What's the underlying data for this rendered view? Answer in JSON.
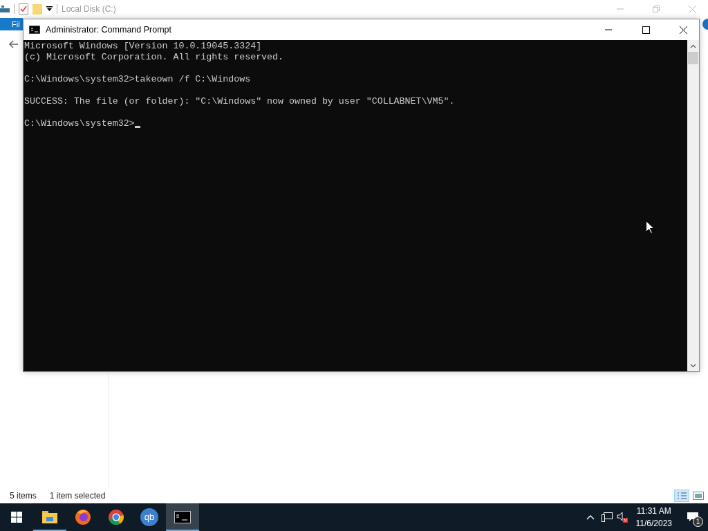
{
  "explorer": {
    "title": "Local Disk (C:)",
    "ribbon_tab": "Fil",
    "status_items": "5 items",
    "status_selected": "1 item selected"
  },
  "console": {
    "title": "Administrator: Command Prompt",
    "blocks": [
      [
        "Microsoft Windows [Version 10.0.19045.3324]",
        "(c) Microsoft Corporation. All rights reserved."
      ],
      [
        "C:\\Windows\\system32>takeown /f C:\\Windows"
      ],
      [
        "SUCCESS: The file (or folder): \"C:\\Windows\" now owned by user \"COLLABNET\\VM5\"."
      ]
    ],
    "prompt": "C:\\Windows\\system32>"
  },
  "taskbar": {
    "apps": [
      {
        "kind": "explorer",
        "running": true,
        "selected": false
      },
      {
        "kind": "firefox",
        "running": false,
        "selected": false
      },
      {
        "kind": "chrome",
        "running": false,
        "selected": false
      },
      {
        "kind": "qb",
        "label": "qb",
        "running": false,
        "selected": false
      },
      {
        "kind": "cmd",
        "running": true,
        "selected": true
      }
    ],
    "time": "11:31 AM",
    "date": "11/6/2023",
    "notifications": "1"
  }
}
